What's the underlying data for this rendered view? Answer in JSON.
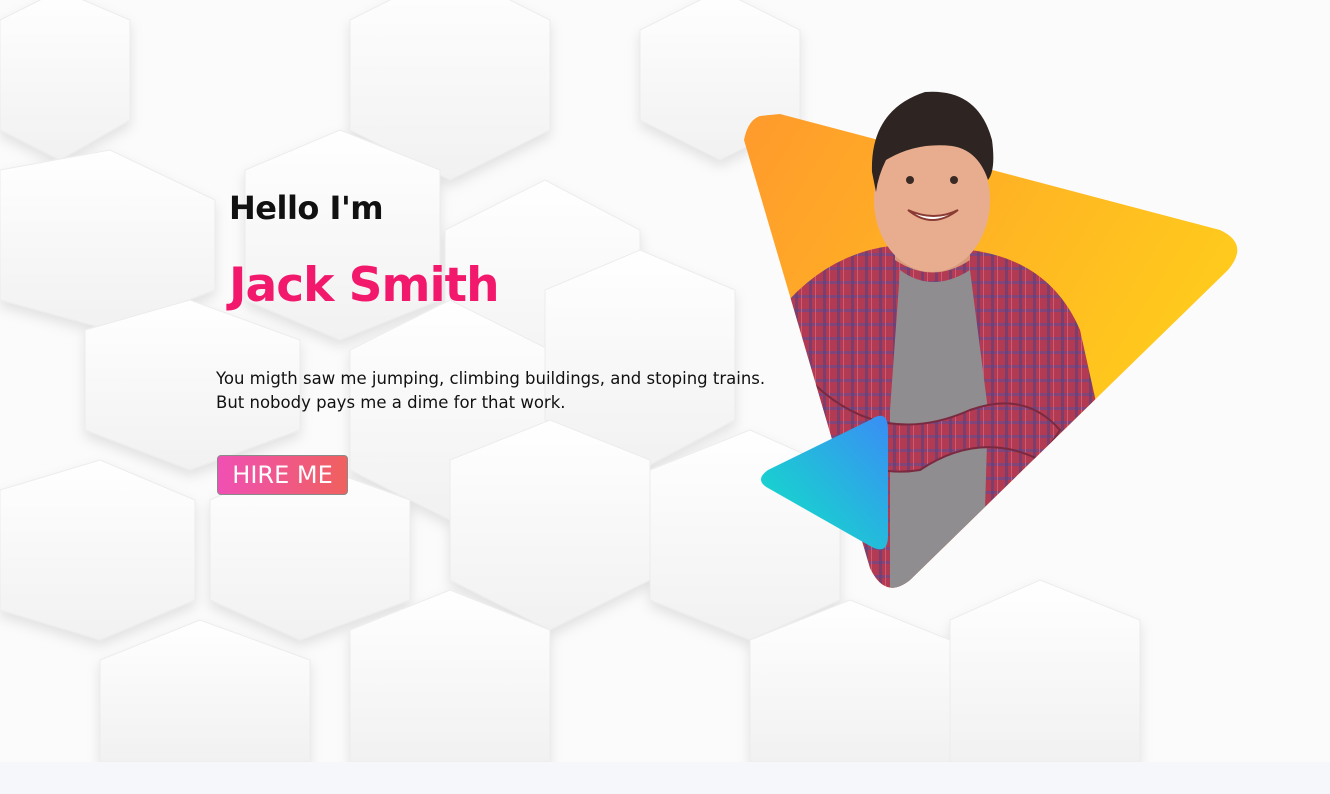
{
  "hero": {
    "greeting": "Hello I'm",
    "name": "Jack Smith",
    "bio_line1": "You migth saw me jumping, climbing buildings, and stoping trains.",
    "bio_line2": "But nobody pays me a dime for that work.",
    "cta_label": "HIRE ME"
  },
  "colors": {
    "name_accent": "#f2196d",
    "cta_gradient_start": "#f050b4",
    "cta_gradient_end": "#f0605e",
    "triangle_orange": "#ff9f2e",
    "triangle_yellow": "#ffd21a",
    "play_blue": "#3a8df5",
    "play_teal": "#0ee6c4",
    "background": "#fbfbfb"
  },
  "icons": {
    "play": "play-triangle-icon"
  }
}
